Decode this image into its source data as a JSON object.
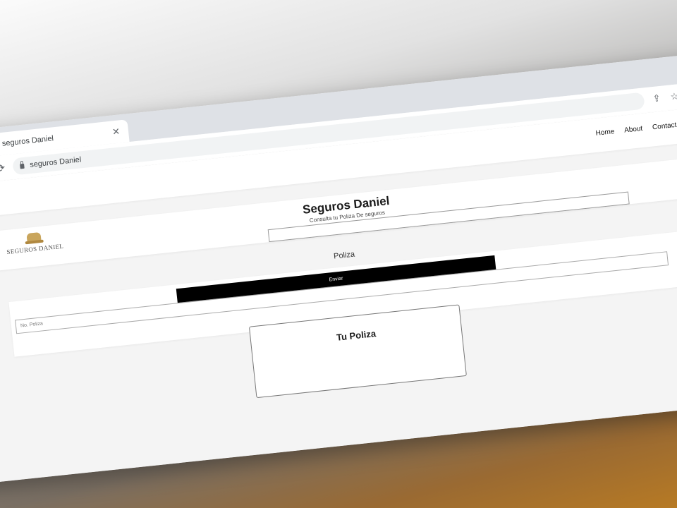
{
  "browser": {
    "tab_title": "seguros Daniel",
    "url": "seguros Daniel",
    "icons": {
      "tab_close": "close-icon",
      "reload": "reload-icon",
      "lock": "lock-icon",
      "share": "share-icon",
      "bookmark": "star-icon",
      "menu": "more-vert-icon"
    }
  },
  "nav": {
    "links": [
      "Home",
      "About",
      "Contact"
    ]
  },
  "header": {
    "logo_text": "SEGUROS DANIEL",
    "title": "Seguros Daniel",
    "subtitle": "Consulta tu Poliza De seguros"
  },
  "form": {
    "section_title": "Poliza",
    "input_placeholder": "No. Poliza",
    "button_label": "Enviar"
  },
  "result": {
    "title": "Tu Poliza"
  }
}
